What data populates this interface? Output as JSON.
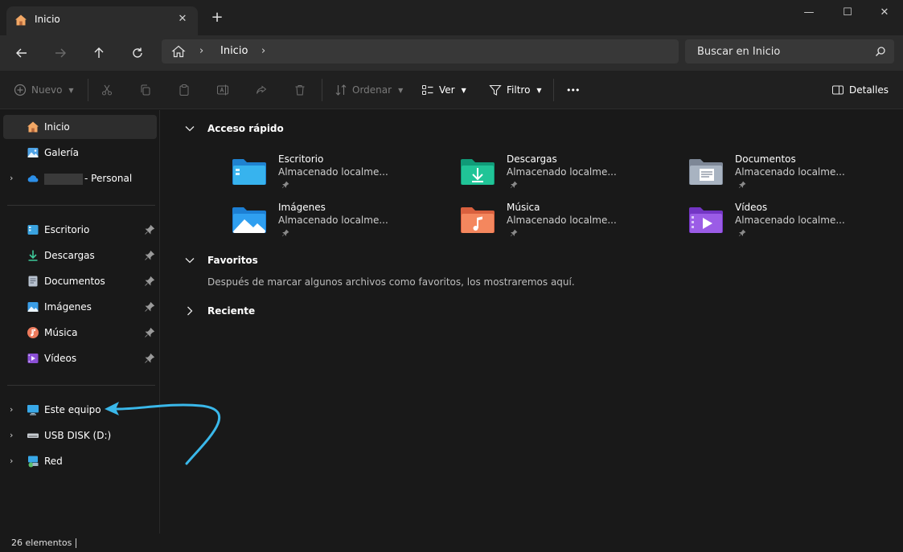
{
  "window": {
    "tab_label": "Inicio",
    "tab_close": "✕",
    "new_tab": "+",
    "minimize": "—",
    "maximize": "☐",
    "close": "✕"
  },
  "address": {
    "location": "Inicio",
    "search_placeholder": "Buscar en Inicio"
  },
  "commands": {
    "new": "Nuevo",
    "sort": "Ordenar",
    "view": "Ver",
    "filter": "Filtro",
    "more": "•••",
    "details": "Detalles"
  },
  "sidebar": {
    "top": [
      {
        "label": "Inicio",
        "icon": "home-icon",
        "active": true
      },
      {
        "label": "Galería",
        "icon": "gallery-icon"
      },
      {
        "label": "- Personal",
        "icon": "onedrive-icon"
      }
    ],
    "pinned": [
      {
        "label": "Escritorio",
        "icon": "desktop-icon"
      },
      {
        "label": "Descargas",
        "icon": "downloads-icon"
      },
      {
        "label": "Documentos",
        "icon": "documents-icon"
      },
      {
        "label": "Imágenes",
        "icon": "pictures-icon"
      },
      {
        "label": "Música",
        "icon": "music-icon"
      },
      {
        "label": "Vídeos",
        "icon": "videos-icon"
      }
    ],
    "devices": [
      {
        "label": "Este equipo",
        "icon": "computer-icon"
      },
      {
        "label": "USB DISK (D:)",
        "icon": "usb-drive-icon"
      },
      {
        "label": "Red",
        "icon": "network-icon"
      }
    ]
  },
  "main": {
    "quick_access": {
      "title": "Acceso rápido",
      "items": [
        {
          "name": "Escritorio",
          "sub": "Almacenado localme...",
          "icon": "desktop-folder-icon"
        },
        {
          "name": "Descargas",
          "sub": "Almacenado localme...",
          "icon": "downloads-folder-icon"
        },
        {
          "name": "Documentos",
          "sub": "Almacenado localme...",
          "icon": "documents-folder-icon"
        },
        {
          "name": "Imágenes",
          "sub": "Almacenado localme...",
          "icon": "pictures-folder-icon"
        },
        {
          "name": "Música",
          "sub": "Almacenado localme...",
          "icon": "music-folder-icon"
        },
        {
          "name": "Vídeos",
          "sub": "Almacenado localme...",
          "icon": "videos-folder-icon"
        }
      ]
    },
    "favorites": {
      "title": "Favoritos",
      "message": "Después de marcar algunos archivos como favoritos, los mostraremos aquí."
    },
    "recent": {
      "title": "Reciente"
    }
  },
  "status": {
    "count": "26 elementos"
  },
  "colors": {
    "accent": "#4cc2ff",
    "annotation_arrow": "#3ab8ea"
  }
}
